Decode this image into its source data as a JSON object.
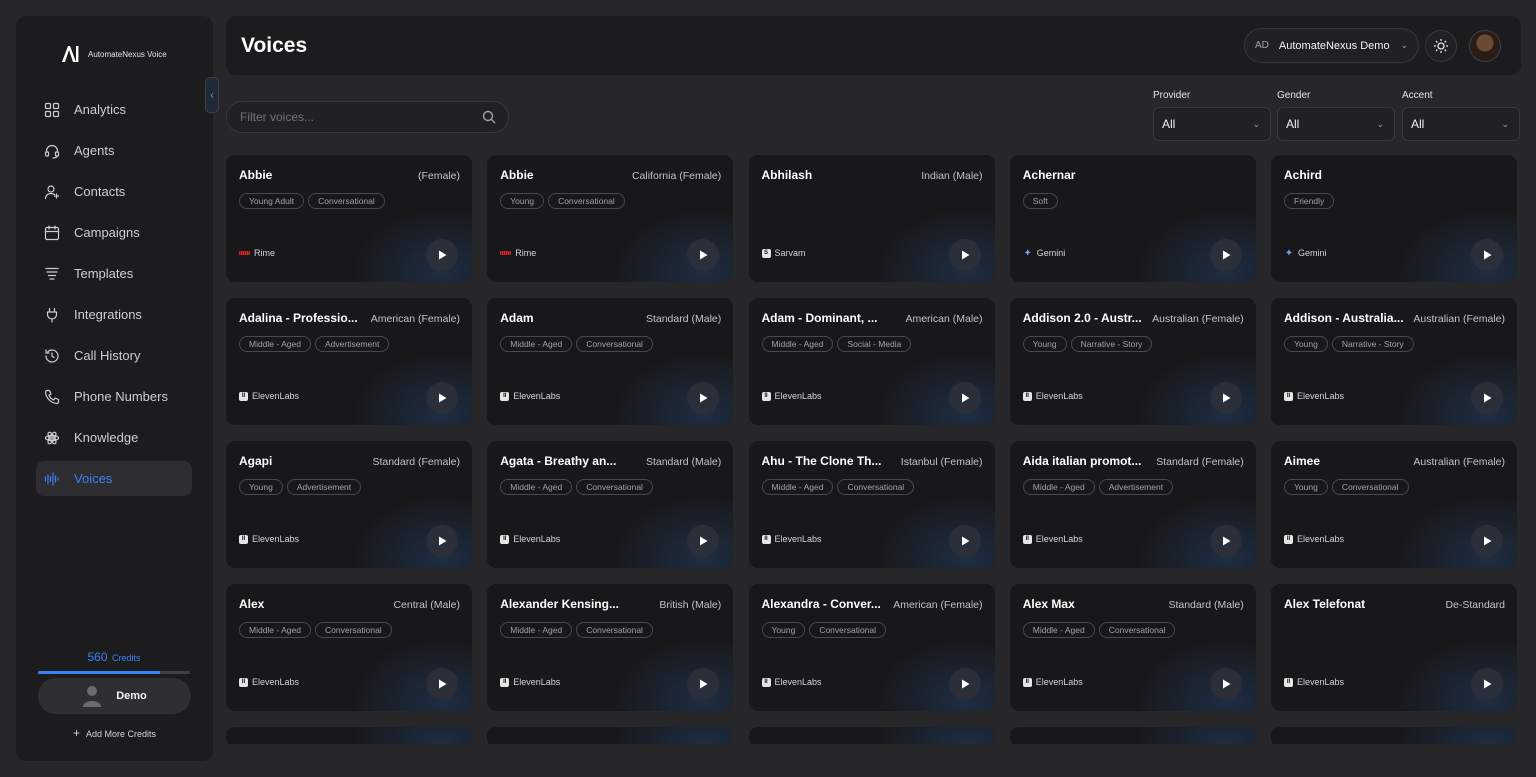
{
  "brand": {
    "name": "AutomateNexus Voice"
  },
  "sidebar": {
    "items": [
      {
        "label": "Analytics",
        "icon": "grid-icon"
      },
      {
        "label": "Agents",
        "icon": "headset-icon"
      },
      {
        "label": "Contacts",
        "icon": "user-icon"
      },
      {
        "label": "Campaigns",
        "icon": "calendar-icon"
      },
      {
        "label": "Templates",
        "icon": "funnel-icon"
      },
      {
        "label": "Integrations",
        "icon": "plug-icon"
      },
      {
        "label": "Call History",
        "icon": "history-icon"
      },
      {
        "label": "Phone Numbers",
        "icon": "phone-icon"
      },
      {
        "label": "Knowledge",
        "icon": "atom-icon"
      },
      {
        "label": "Voices",
        "icon": "waveform-icon",
        "active": true
      }
    ],
    "credits_value": "560",
    "credits_unit": "Credits",
    "credits_fill_fraction": 0.8,
    "user_name": "Demo",
    "add_credits_label": "Add More Credits"
  },
  "header": {
    "title": "Voices",
    "account_initials": "AD",
    "account_name": "AutomateNexus Demo"
  },
  "filters": {
    "search_placeholder": "Filter voices...",
    "provider_label": "Provider",
    "provider_value": "All",
    "gender_label": "Gender",
    "gender_value": "All",
    "accent_label": "Accent",
    "accent_value": "All"
  },
  "colors": {
    "accent": "#3b82f6",
    "card_bg": "#18181b",
    "page_bg": "#27272a"
  },
  "voices": [
    {
      "name": "Abbie",
      "meta": "(Female)",
      "tags": [
        "Young Adult",
        "Conversational"
      ],
      "provider": "Rime",
      "provider_icon": "rime"
    },
    {
      "name": "Abbie",
      "meta": "California (Female)",
      "tags": [
        "Young",
        "Conversational"
      ],
      "provider": "Rime",
      "provider_icon": "rime"
    },
    {
      "name": "Abhilash",
      "meta": "Indian (Male)",
      "tags": [],
      "provider": "Sarvam",
      "provider_icon": "box"
    },
    {
      "name": "Achernar",
      "meta": "",
      "tags": [
        "Soft"
      ],
      "provider": "Gemini",
      "provider_icon": "gemini"
    },
    {
      "name": "Achird",
      "meta": "",
      "tags": [
        "Friendly"
      ],
      "provider": "Gemini",
      "provider_icon": "gemini"
    },
    {
      "name": "Adalina - Professio...",
      "meta": "American (Female)",
      "tags": [
        "Middle - Aged",
        "Advertisement"
      ],
      "provider": "ElevenLabs",
      "provider_icon": "box"
    },
    {
      "name": "Adam",
      "meta": "Standard (Male)",
      "tags": [
        "Middle - Aged",
        "Conversational"
      ],
      "provider": "ElevenLabs",
      "provider_icon": "box"
    },
    {
      "name": "Adam - Dominant, ...",
      "meta": "American (Male)",
      "tags": [
        "Middle - Aged",
        "Social - Media"
      ],
      "provider": "ElevenLabs",
      "provider_icon": "box"
    },
    {
      "name": "Addison 2.0 - Austr...",
      "meta": "Australian (Female)",
      "tags": [
        "Young",
        "Narrative - Story"
      ],
      "provider": "ElevenLabs",
      "provider_icon": "box"
    },
    {
      "name": "Addison - Australia...",
      "meta": "Australian (Female)",
      "tags": [
        "Young",
        "Narrative - Story"
      ],
      "provider": "ElevenLabs",
      "provider_icon": "box"
    },
    {
      "name": "Agapi",
      "meta": "Standard (Female)",
      "tags": [
        "Young",
        "Advertisement"
      ],
      "provider": "ElevenLabs",
      "provider_icon": "box"
    },
    {
      "name": "Agata - Breathy an...",
      "meta": "Standard (Male)",
      "tags": [
        "Middle - Aged",
        "Conversational"
      ],
      "provider": "ElevenLabs",
      "provider_icon": "box"
    },
    {
      "name": "Ahu - The Clone Th...",
      "meta": "Istanbul (Female)",
      "tags": [
        "Middle - Aged",
        "Conversational"
      ],
      "provider": "ElevenLabs",
      "provider_icon": "box"
    },
    {
      "name": "Aida italian promot...",
      "meta": "Standard (Female)",
      "tags": [
        "Middle - Aged",
        "Advertisement"
      ],
      "provider": "ElevenLabs",
      "provider_icon": "box"
    },
    {
      "name": "Aimee",
      "meta": "Australian (Female)",
      "tags": [
        "Young",
        "Conversational"
      ],
      "provider": "ElevenLabs",
      "provider_icon": "box"
    },
    {
      "name": "Alex",
      "meta": "Central (Male)",
      "tags": [
        "Middle - Aged",
        "Conversational"
      ],
      "provider": "ElevenLabs",
      "provider_icon": "box"
    },
    {
      "name": "Alexander Kensing...",
      "meta": "British (Male)",
      "tags": [
        "Middle - Aged",
        "Conversational"
      ],
      "provider": "ElevenLabs",
      "provider_icon": "box"
    },
    {
      "name": "Alexandra - Conver...",
      "meta": "American (Female)",
      "tags": [
        "Young",
        "Conversational"
      ],
      "provider": "ElevenLabs",
      "provider_icon": "box"
    },
    {
      "name": "Alex Max",
      "meta": "Standard (Male)",
      "tags": [
        "Middle - Aged",
        "Conversational"
      ],
      "provider": "ElevenLabs",
      "provider_icon": "box"
    },
    {
      "name": "Alex Telefonat",
      "meta": "De-Standard",
      "tags": [],
      "provider": "ElevenLabs",
      "provider_icon": "box"
    }
  ]
}
